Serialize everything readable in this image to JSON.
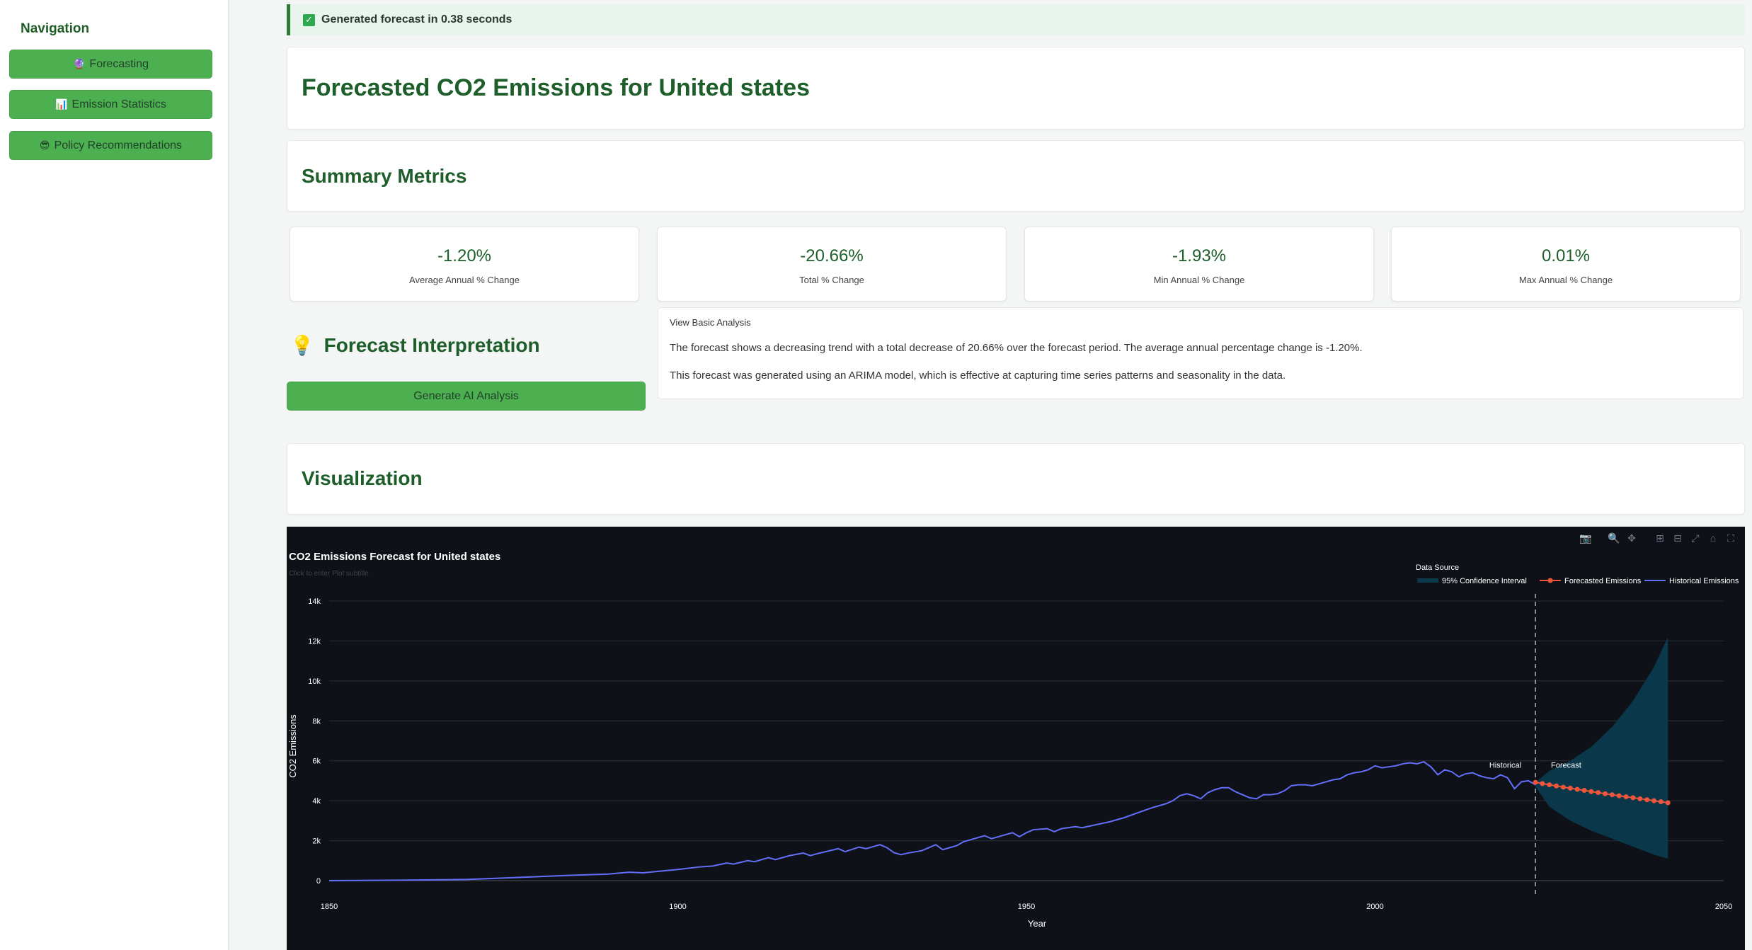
{
  "sidebar": {
    "title": "Navigation",
    "items": [
      {
        "icon": "crystal-ball-icon",
        "glyph": "🔮",
        "label": "Forecasting"
      },
      {
        "icon": "bar-chart-icon",
        "glyph": "📊",
        "label": "Emission Statistics"
      },
      {
        "icon": "sunglasses-icon",
        "glyph": "😎",
        "label": "Policy Recommendations"
      }
    ]
  },
  "toast": {
    "text": "Generated forecast in 0.38 seconds",
    "icon": "check-icon"
  },
  "page_title": "Forecasted CO2 Emissions for United states",
  "summary": {
    "title": "Summary Metrics",
    "metrics": [
      {
        "value": "-1.20%",
        "label": "Average Annual % Change"
      },
      {
        "value": "-20.66%",
        "label": "Total % Change"
      },
      {
        "value": "-1.93%",
        "label": "Min Annual % Change"
      },
      {
        "value": "0.01%",
        "label": "Max Annual % Change"
      }
    ]
  },
  "interpretation": {
    "title": "Forecast Interpretation",
    "icon": "lightbulb-icon",
    "button": "Generate AI Analysis",
    "expander_label": "View Basic Analysis",
    "paragraphs": [
      "The forecast shows a decreasing trend with a total decrease of 20.66% over the forecast period. The average annual percentage change is -1.20%.",
      "This forecast was generated using an ARIMA model, which is effective at capturing time series patterns and seasonality in the data."
    ]
  },
  "visualization": {
    "title": "Visualization"
  },
  "colors": {
    "accent": "#4caf50",
    "heading": "#1d5e2a",
    "historical": "#636efa",
    "forecast": "#ef553b",
    "ci": "#0b3a4d",
    "chart_bg": "#0e1117"
  },
  "chart_data": {
    "type": "line",
    "title": "CO2 Emissions Forecast for United states",
    "subtitle_placeholder": "Click to enter Plot subtitle",
    "xlabel": "Year",
    "ylabel": "CO2 Emissions",
    "xlim": [
      1850,
      2050
    ],
    "ylim": [
      0,
      14000
    ],
    "x_ticks": [
      "1850",
      "1900",
      "1950",
      "2000",
      "2050"
    ],
    "y_ticks": [
      "0",
      "2k",
      "4k",
      "6k",
      "8k",
      "10k",
      "12k",
      "14k"
    ],
    "grid": true,
    "legend_title": "Data Source",
    "legend_position": "top-right",
    "annotations": [
      {
        "text": "Historical"
      },
      {
        "text": "Forecast"
      }
    ],
    "split_year": 2023,
    "series": [
      {
        "name": "Historical Emissions",
        "points": [
          [
            1850,
            0
          ],
          [
            1860,
            20
          ],
          [
            1870,
            60
          ],
          [
            1880,
            200
          ],
          [
            1885,
            270
          ],
          [
            1890,
            330
          ],
          [
            1893,
            420
          ],
          [
            1895,
            390
          ],
          [
            1900,
            560
          ],
          [
            1903,
            680
          ],
          [
            1905,
            730
          ],
          [
            1907,
            880
          ],
          [
            1908,
            830
          ],
          [
            1910,
            1000
          ],
          [
            1911,
            950
          ],
          [
            1913,
            1150
          ],
          [
            1914,
            1050
          ],
          [
            1916,
            1250
          ],
          [
            1918,
            1380
          ],
          [
            1919,
            1250
          ],
          [
            1920,
            1350
          ],
          [
            1923,
            1600
          ],
          [
            1924,
            1450
          ],
          [
            1926,
            1680
          ],
          [
            1927,
            1600
          ],
          [
            1928,
            1700
          ],
          [
            1929,
            1800
          ],
          [
            1930,
            1650
          ],
          [
            1931,
            1400
          ],
          [
            1932,
            1300
          ],
          [
            1933,
            1380
          ],
          [
            1935,
            1500
          ],
          [
            1936,
            1650
          ],
          [
            1937,
            1800
          ],
          [
            1938,
            1550
          ],
          [
            1940,
            1750
          ],
          [
            1941,
            1950
          ],
          [
            1942,
            2050
          ],
          [
            1944,
            2250
          ],
          [
            1945,
            2100
          ],
          [
            1946,
            2200
          ],
          [
            1948,
            2400
          ],
          [
            1949,
            2200
          ],
          [
            1950,
            2400
          ],
          [
            1951,
            2550
          ],
          [
            1953,
            2600
          ],
          [
            1954,
            2450
          ],
          [
            1955,
            2600
          ],
          [
            1957,
            2700
          ],
          [
            1958,
            2650
          ],
          [
            1960,
            2800
          ],
          [
            1962,
            2950
          ],
          [
            1964,
            3150
          ],
          [
            1966,
            3400
          ],
          [
            1968,
            3650
          ],
          [
            1970,
            3850
          ],
          [
            1971,
            4000
          ],
          [
            1972,
            4250
          ],
          [
            1973,
            4350
          ],
          [
            1974,
            4250
          ],
          [
            1975,
            4100
          ],
          [
            1976,
            4400
          ],
          [
            1977,
            4550
          ],
          [
            1978,
            4650
          ],
          [
            1979,
            4650
          ],
          [
            1980,
            4450
          ],
          [
            1981,
            4300
          ],
          [
            1982,
            4150
          ],
          [
            1983,
            4100
          ],
          [
            1984,
            4300
          ],
          [
            1985,
            4300
          ],
          [
            1986,
            4350
          ],
          [
            1987,
            4500
          ],
          [
            1988,
            4750
          ],
          [
            1989,
            4800
          ],
          [
            1990,
            4800
          ],
          [
            1991,
            4750
          ],
          [
            1992,
            4850
          ],
          [
            1993,
            4950
          ],
          [
            1994,
            5050
          ],
          [
            1995,
            5100
          ],
          [
            1996,
            5300
          ],
          [
            1997,
            5400
          ],
          [
            1998,
            5450
          ],
          [
            1999,
            5550
          ],
          [
            2000,
            5750
          ],
          [
            2001,
            5650
          ],
          [
            2002,
            5700
          ],
          [
            2003,
            5750
          ],
          [
            2004,
            5850
          ],
          [
            2005,
            5900
          ],
          [
            2006,
            5850
          ],
          [
            2007,
            5950
          ],
          [
            2008,
            5700
          ],
          [
            2009,
            5300
          ],
          [
            2010,
            5550
          ],
          [
            2011,
            5450
          ],
          [
            2012,
            5200
          ],
          [
            2013,
            5350
          ],
          [
            2014,
            5400
          ],
          [
            2015,
            5250
          ],
          [
            2016,
            5150
          ],
          [
            2017,
            5100
          ],
          [
            2018,
            5300
          ],
          [
            2019,
            5150
          ],
          [
            2020,
            4600
          ],
          [
            2021,
            4950
          ],
          [
            2022,
            5000
          ],
          [
            2023,
            4800
          ]
        ]
      },
      {
        "name": "Forecasted Emissions",
        "points": [
          [
            2023,
            4920
          ],
          [
            2024,
            4860
          ],
          [
            2025,
            4800
          ],
          [
            2026,
            4740
          ],
          [
            2027,
            4680
          ],
          [
            2028,
            4630
          ],
          [
            2029,
            4570
          ],
          [
            2030,
            4520
          ],
          [
            2031,
            4460
          ],
          [
            2032,
            4410
          ],
          [
            2033,
            4350
          ],
          [
            2034,
            4300
          ],
          [
            2035,
            4250
          ],
          [
            2036,
            4200
          ],
          [
            2037,
            4150
          ],
          [
            2038,
            4100
          ],
          [
            2039,
            4050
          ],
          [
            2040,
            4000
          ],
          [
            2041,
            3950
          ],
          [
            2042,
            3900
          ]
        ]
      },
      {
        "name": "95% Confidence Interval",
        "upper": [
          [
            2023,
            4920
          ],
          [
            2025,
            5500
          ],
          [
            2028,
            6000
          ],
          [
            2031,
            6700
          ],
          [
            2034,
            7700
          ],
          [
            2037,
            9000
          ],
          [
            2040,
            10700
          ],
          [
            2042,
            12200
          ]
        ],
        "lower": [
          [
            2023,
            4700
          ],
          [
            2025,
            3700
          ],
          [
            2028,
            3000
          ],
          [
            2031,
            2500
          ],
          [
            2034,
            2100
          ],
          [
            2037,
            1700
          ],
          [
            2040,
            1300
          ],
          [
            2042,
            1100
          ]
        ]
      }
    ]
  }
}
